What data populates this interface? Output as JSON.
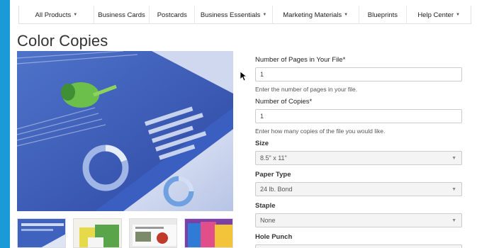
{
  "nav": {
    "items": [
      {
        "label": "All Products",
        "caret": true
      },
      {
        "label": "Business Cards",
        "caret": false
      },
      {
        "label": "Postcards",
        "caret": false
      },
      {
        "label": "Business Essentials",
        "caret": true
      },
      {
        "label": "Marketing Materials",
        "caret": true
      },
      {
        "label": "Blueprints",
        "caret": false
      },
      {
        "label": "Help Center",
        "caret": true
      }
    ]
  },
  "page_title": "Color Copies",
  "form": {
    "pages": {
      "label": "Number of Pages in Your File*",
      "value": "1",
      "help": "Enter the number of pages in your file."
    },
    "copies": {
      "label": "Number of Copies*",
      "value": "1",
      "help": "Enter how many copies of the file you would like."
    },
    "size": {
      "label": "Size",
      "value": "8.5\" x 11\""
    },
    "paper_type": {
      "label": "Paper Type",
      "value": "24 lb. Bond"
    },
    "staple": {
      "label": "Staple",
      "value": "None"
    },
    "hole_punch": {
      "label": "Hole Punch",
      "value": ""
    }
  },
  "colors": {
    "accent": "#1a9ad6"
  },
  "icons": {
    "caret": "caret-down-icon",
    "select": "chevron-down-icon",
    "cursor": "mouse-pointer-icon"
  }
}
